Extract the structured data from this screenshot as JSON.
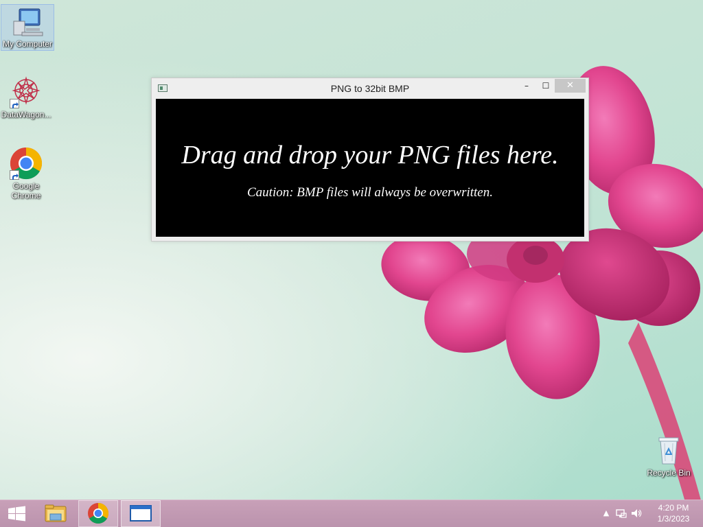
{
  "desktop": {
    "icons": [
      {
        "label": "My Computer",
        "icon": "my-computer-icon"
      },
      {
        "label": "DataWagon...",
        "icon": "datawagon-icon"
      },
      {
        "label": "Google Chrome",
        "icon": "chrome-icon"
      },
      {
        "label": "Recycle Bin",
        "icon": "recycle-bin-icon"
      }
    ]
  },
  "window": {
    "title": "PNG to 32bit BMP",
    "controls": {
      "minimize": "–",
      "maximize": "☐",
      "close": "✕"
    },
    "drop_heading": "Drag and drop your PNG files here.",
    "drop_caution": "Caution: BMP files will always be overwritten."
  },
  "taskbar": {
    "buttons": [
      {
        "icon": "windows-start-icon"
      },
      {
        "icon": "file-explorer-icon"
      },
      {
        "icon": "chrome-icon"
      },
      {
        "icon": "app-window-icon"
      }
    ],
    "tray": {
      "icons": [
        "chevron-up-icon",
        "network-icon",
        "speaker-icon"
      ],
      "time": "4:20 PM",
      "date": "1/3/2023"
    }
  },
  "colors": {
    "taskbar": "#bb93ad",
    "drop_zone": "#000000",
    "flower": "#e24590"
  }
}
